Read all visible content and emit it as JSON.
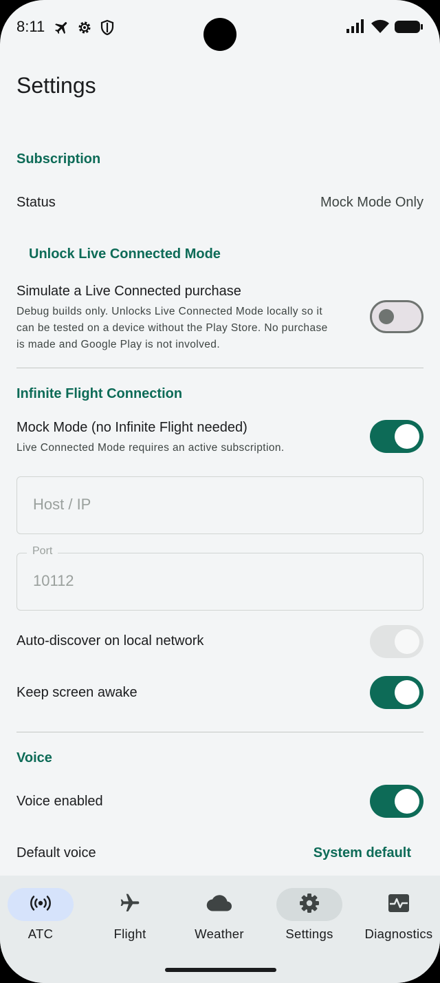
{
  "status_bar": {
    "time": "8:11",
    "left_icons": [
      "airplane-mode-icon",
      "gear-icon",
      "shield-icon"
    ],
    "right_icons": [
      "signal-icon",
      "wifi-icon",
      "battery-icon"
    ]
  },
  "page": {
    "title": "Settings"
  },
  "subscription": {
    "header": "Subscription",
    "status_label": "Status",
    "status_value": "Mock Mode Only",
    "unlock_label": "Unlock Live Connected Mode",
    "simulate_label": "Simulate a Live Connected purchase",
    "simulate_desc_1": "Debug builds only. Unlocks Live Connected Mode locally so it",
    "simulate_desc_2": "can be tested on a device without the Play Store. No purchase",
    "simulate_desc_3": "is made and Google Play is not involved.",
    "simulate_on": false
  },
  "connection": {
    "header": "Infinite Flight Connection",
    "mock_label": "Mock Mode (no Infinite Flight needed)",
    "mock_desc": "Live Connected Mode requires an active subscription.",
    "mock_on": true,
    "host_placeholder": "Host / IP",
    "port_label": "Port",
    "port_value": "10112",
    "autodiscover_label": "Auto-discover on local network",
    "autodiscover_on": true,
    "autodiscover_enabled": false,
    "keep_awake_label": "Keep screen awake",
    "keep_awake_on": true
  },
  "voice": {
    "header": "Voice",
    "enabled_label": "Voice enabled",
    "enabled_on": true,
    "default_voice_label": "Default voice",
    "default_voice_value": "System default"
  },
  "bottom_nav": {
    "items": [
      {
        "label": "ATC",
        "icon": "radio-broadcast-icon",
        "selected": false,
        "highlight": "light-blue"
      },
      {
        "label": "Flight",
        "icon": "airplane-icon",
        "selected": false
      },
      {
        "label": "Weather",
        "icon": "cloud-icon",
        "selected": false
      },
      {
        "label": "Settings",
        "icon": "gear-icon",
        "selected": true
      },
      {
        "label": "Diagnostics",
        "icon": "monitor-heart-icon",
        "selected": false
      }
    ]
  },
  "colors": {
    "accent": "#0d6b57",
    "background": "#f3f5f6",
    "nav_background": "#e7ebec",
    "atc_pill": "#d6e3fb",
    "settings_pill": "#d5dbdc"
  }
}
